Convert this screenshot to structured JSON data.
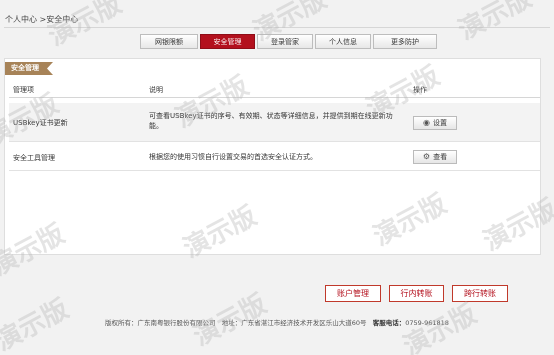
{
  "breadcrumb": "个人中心 >安全中心",
  "tabs": [
    {
      "label": "网银限额",
      "active": false
    },
    {
      "label": "安全管理",
      "active": true
    },
    {
      "label": "登录管家",
      "active": false
    },
    {
      "label": "个人信息",
      "active": false
    },
    {
      "label": "更多防护",
      "active": false
    }
  ],
  "panel": {
    "title": "安全管理",
    "headers": {
      "item": "管理项",
      "desc": "说明",
      "action": "操作"
    },
    "rows": [
      {
        "item": "USBkey证书更新",
        "desc_line1": "可查看USBkey证书的序号、有效期、状态等详细信息，并提供到期在线更新功",
        "desc_line2": "能。",
        "button": "设置",
        "icon": "eye-icon"
      },
      {
        "item": "安全工具管理",
        "desc_line1": "根据您的使用习惯自行设置交易的首选安全认证方式。",
        "desc_line2": "",
        "button": "查看",
        "icon": "gear-icon"
      }
    ]
  },
  "bottom_buttons": {
    "account": "账户管理",
    "transfer_in": "行内转账",
    "transfer_cross": "跨行转账"
  },
  "footer": {
    "copyright": "版权所有：广东南粤银行股份有限公司",
    "address": "地址：广东省湛江市经济技术开发区乐山大道60号",
    "hotline_label": "客服电话：",
    "hotline": "0759-961818"
  },
  "watermark": "演示版",
  "colors": {
    "accent": "#b3101d",
    "panel_title": "#a78358",
    "background": "#f2f2f2"
  }
}
